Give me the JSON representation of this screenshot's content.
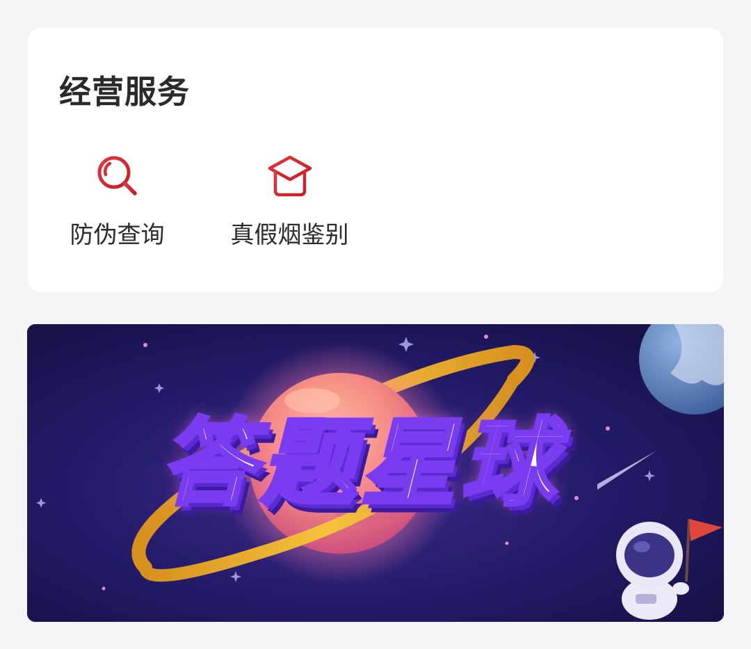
{
  "services_card": {
    "title": "经营服务",
    "items": [
      {
        "label": "防伪查询",
        "icon": "magnifier-icon"
      },
      {
        "label": "真假烟鉴别",
        "icon": "graduation-cap-icon"
      }
    ],
    "accent_color": "#d8232a"
  },
  "banner": {
    "title": "答题星球",
    "background_color": "#1c1650"
  }
}
